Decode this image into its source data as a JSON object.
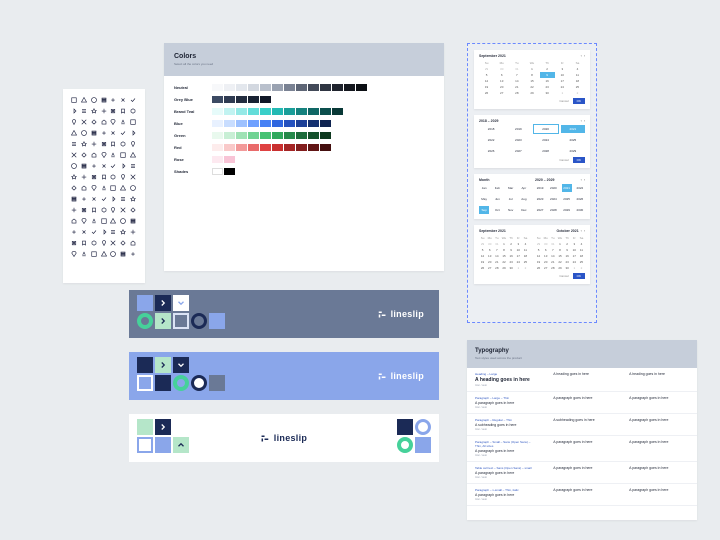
{
  "colors_card": {
    "title": "Colors",
    "subtitle": "Select all the colors you need",
    "palettes": [
      {
        "name": "Neutral",
        "swatches": [
          "#f7f8fa",
          "#eef0f4",
          "#e3e7ed",
          "#d3d8e0",
          "#b9c0cc",
          "#9aa2b1",
          "#7a8293",
          "#5e6676",
          "#434a59",
          "#2f3542",
          "#1f232d",
          "#14171e",
          "#0c0f14"
        ]
      },
      {
        "name": "Grey Blue",
        "swatches": [
          "#3c4a63",
          "#2f3b52",
          "#232d40",
          "#192233",
          "#101727"
        ]
      },
      {
        "name": "Brand Teal",
        "swatches": [
          "#e6fbfa",
          "#c1f3f1",
          "#95e9e6",
          "#63ddd9",
          "#3acfc9",
          "#22b9b3",
          "#1a9e99",
          "#15827e",
          "#106765",
          "#0c4f4d",
          "#083836"
        ]
      },
      {
        "name": "Blue",
        "swatches": [
          "#e8f1ff",
          "#c8ddff",
          "#9dc1ff",
          "#6ea0ff",
          "#4681f5",
          "#2e66e0",
          "#2451bf",
          "#1c3f97",
          "#14306f",
          "#0e2350"
        ]
      },
      {
        "name": "Green",
        "swatches": [
          "#e9f9ee",
          "#c8efd5",
          "#9fe2b5",
          "#70d393",
          "#46c273",
          "#2fa95c",
          "#25894a",
          "#1c6b3a",
          "#14502b",
          "#0e391f"
        ]
      },
      {
        "name": "Red",
        "swatches": [
          "#fdecec",
          "#f9c9c9",
          "#f29a9a",
          "#e96b6b",
          "#df4242",
          "#c92f2f",
          "#a52525",
          "#821d1d",
          "#611515",
          "#440f0f"
        ]
      },
      {
        "name": "Rose",
        "swatches": [
          "#fde9f0",
          "#f8c4d6"
        ]
      },
      {
        "name": "Shades",
        "swatches": [
          "#ffffff",
          "#000000"
        ]
      }
    ]
  },
  "calendars": {
    "single": {
      "label": "September 2021",
      "dow": [
        "Su",
        "Mo",
        "Tu",
        "We",
        "Th",
        "Fr",
        "Sa"
      ],
      "weeks": [
        [
          {
            "n": 29,
            "dim": true
          },
          {
            "n": 30,
            "dim": true
          },
          {
            "n": 31,
            "dim": true
          },
          {
            "n": 1
          },
          {
            "n": 2
          },
          {
            "n": 3
          },
          {
            "n": 4
          }
        ],
        [
          {
            "n": 5
          },
          {
            "n": 6
          },
          {
            "n": 7
          },
          {
            "n": 8
          },
          {
            "n": 9,
            "sel": true
          },
          {
            "n": 10
          },
          {
            "n": 11
          }
        ],
        [
          {
            "n": 12
          },
          {
            "n": 13
          },
          {
            "n": 14
          },
          {
            "n": 15
          },
          {
            "n": 16
          },
          {
            "n": 17
          },
          {
            "n": 18
          }
        ],
        [
          {
            "n": 19
          },
          {
            "n": 20
          },
          {
            "n": 21
          },
          {
            "n": 22
          },
          {
            "n": 23
          },
          {
            "n": 24
          },
          {
            "n": 25
          }
        ],
        [
          {
            "n": 26
          },
          {
            "n": 27
          },
          {
            "n": 28
          },
          {
            "n": 29
          },
          {
            "n": 30
          },
          {
            "n": 1,
            "dim": true
          },
          {
            "n": 2,
            "dim": true
          }
        ]
      ]
    },
    "year_pick": {
      "items": [
        "2018",
        "2019",
        "2020",
        "2021",
        "2022",
        "2023",
        "2024",
        "2025",
        "2026",
        "2027",
        "2028",
        "2029"
      ],
      "sel": 2,
      "hl": 3
    },
    "month_pick": {
      "items": [
        "Jan",
        "Feb",
        "Mar",
        "Apr",
        "May",
        "Jun",
        "Jul",
        "Aug",
        "Sep",
        "Oct",
        "Nov",
        "Dec"
      ],
      "hl": 8
    },
    "decade_pick": {
      "title": "2020 – 2029",
      "items": [
        "2019",
        "2020",
        "2021",
        "2022",
        "2023",
        "2024",
        "2025",
        "2026",
        "2027",
        "2028",
        "2029",
        "2030"
      ],
      "hl": 2
    },
    "double": {
      "left": "September 2021",
      "right": "October 2021",
      "dow": [
        "Su",
        "Mo",
        "Tu",
        "We",
        "Th",
        "Fr",
        "Sa"
      ]
    },
    "cancel": "Cancel",
    "ok": "OK"
  },
  "typography": {
    "title": "Typography",
    "subtitle": "Text styles used across the product",
    "rows": [
      {
        "cat": "Heading – Large",
        "s1": "A heading goes in here",
        "s1b": true,
        "s2": "A heading goes in here",
        "s3": "A heading goes in here"
      },
      {
        "cat": "Paragraph – Large – Thin",
        "s1": "A paragraph goes in here",
        "s2": "A paragraph goes in here",
        "s3": "A paragraph goes in here"
      },
      {
        "cat": "Paragraph – Regular – Thin",
        "s1": "A subheading goes in here",
        "s2": "A subheading goes in here",
        "s3": "A paragraph goes in here"
      },
      {
        "cat": "Paragraph – Small – Sans (Open Sans) – Thin, All sizes",
        "s1": "A paragraph goes in here",
        "s2": "A paragraph goes in here",
        "s3": "A paragraph goes in here"
      },
      {
        "cat": "Table cell text – Sans (Open Sans) – small",
        "s1": "A paragraph goes in here",
        "s2": "A paragraph goes in here",
        "s3": "A paragraph goes in here"
      },
      {
        "cat": "Paragraph – x-small – Thin, italic",
        "s1": "A paragraph goes in here",
        "s2": "A paragraph goes in here",
        "s3": "A paragraph goes in here"
      }
    ]
  },
  "banner_brand": "lineslip"
}
